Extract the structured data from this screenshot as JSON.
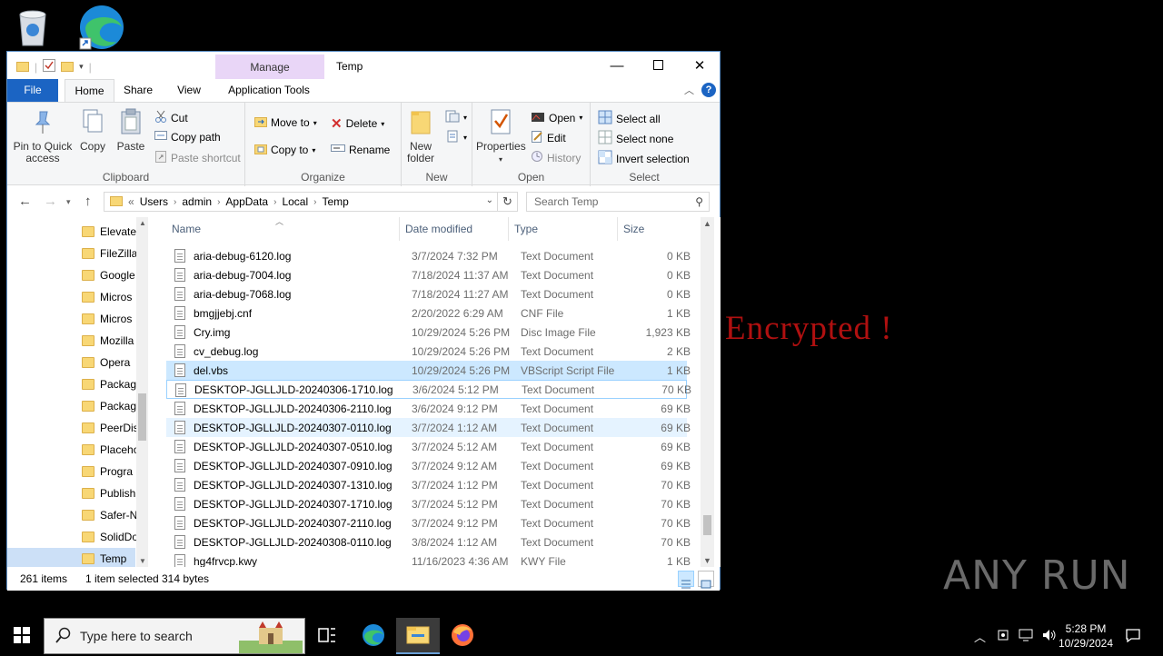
{
  "desktop": {
    "overlay_text": "Encrypted !",
    "watermark": "ANY RUN",
    "icons": [
      "recycle-bin-icon",
      "edge-shortcut-icon"
    ]
  },
  "window": {
    "title": "Temp",
    "manage_tab": "Manage",
    "tabs": {
      "file": "File",
      "home": "Home",
      "share": "Share",
      "view": "View",
      "app_tools": "Application Tools"
    },
    "help": "?"
  },
  "ribbon": {
    "clipboard": {
      "label": "Clipboard",
      "pin": "Pin to Quick access",
      "copy": "Copy",
      "paste": "Paste",
      "cut": "Cut",
      "copy_path": "Copy path",
      "paste_shortcut": "Paste shortcut"
    },
    "organize": {
      "label": "Organize",
      "move_to": "Move to",
      "copy_to": "Copy to",
      "delete": "Delete",
      "rename": "Rename"
    },
    "new": {
      "label": "New",
      "new_folder": "New folder"
    },
    "open": {
      "label": "Open",
      "properties": "Properties",
      "open": "Open",
      "edit": "Edit",
      "history": "History"
    },
    "select": {
      "label": "Select",
      "select_all": "Select all",
      "select_none": "Select none",
      "invert": "Invert selection"
    }
  },
  "address": {
    "crumbs": [
      "Users",
      "admin",
      "AppData",
      "Local",
      "Temp"
    ],
    "prefix": "«",
    "search_placeholder": "Search Temp"
  },
  "nav_pane": [
    "Elevate",
    "FileZilla",
    "Google",
    "Micros",
    "Micros",
    "Mozilla",
    "Opera",
    "Packag",
    "Packag",
    "PeerDis",
    "Placeho",
    "Progra",
    "Publish",
    "Safer-N",
    "SolidDo",
    "Temp"
  ],
  "columns": {
    "name": "Name",
    "date": "Date modified",
    "type": "Type",
    "size": "Size"
  },
  "files": [
    {
      "name": "aria-debug-6120.log",
      "date": "3/7/2024 7:32 PM",
      "type": "Text Document",
      "size": "0 KB"
    },
    {
      "name": "aria-debug-7004.log",
      "date": "7/18/2024 11:37 AM",
      "type": "Text Document",
      "size": "0 KB"
    },
    {
      "name": "aria-debug-7068.log",
      "date": "7/18/2024 11:27 AM",
      "type": "Text Document",
      "size": "0 KB"
    },
    {
      "name": "bmgjjebj.cnf",
      "date": "2/20/2022 6:29 AM",
      "type": "CNF File",
      "size": "1 KB"
    },
    {
      "name": "Cry.img",
      "date": "10/29/2024 5:26 PM",
      "type": "Disc Image File",
      "size": "1,923 KB"
    },
    {
      "name": "cv_debug.log",
      "date": "10/29/2024 5:26 PM",
      "type": "Text Document",
      "size": "2 KB"
    },
    {
      "name": "del.vbs",
      "date": "10/29/2024 5:26 PM",
      "type": "VBScript Script File",
      "size": "1 KB"
    },
    {
      "name": "DESKTOP-JGLLJLD-20240306-1710.log",
      "date": "3/6/2024 5:12 PM",
      "type": "Text Document",
      "size": "70 KB"
    },
    {
      "name": "DESKTOP-JGLLJLD-20240306-2110.log",
      "date": "3/6/2024 9:12 PM",
      "type": "Text Document",
      "size": "69 KB"
    },
    {
      "name": "DESKTOP-JGLLJLD-20240307-0110.log",
      "date": "3/7/2024 1:12 AM",
      "type": "Text Document",
      "size": "69 KB"
    },
    {
      "name": "DESKTOP-JGLLJLD-20240307-0510.log",
      "date": "3/7/2024 5:12 AM",
      "type": "Text Document",
      "size": "69 KB"
    },
    {
      "name": "DESKTOP-JGLLJLD-20240307-0910.log",
      "date": "3/7/2024 9:12 AM",
      "type": "Text Document",
      "size": "69 KB"
    },
    {
      "name": "DESKTOP-JGLLJLD-20240307-1310.log",
      "date": "3/7/2024 1:12 PM",
      "type": "Text Document",
      "size": "70 KB"
    },
    {
      "name": "DESKTOP-JGLLJLD-20240307-1710.log",
      "date": "3/7/2024 5:12 PM",
      "type": "Text Document",
      "size": "70 KB"
    },
    {
      "name": "DESKTOP-JGLLJLD-20240307-2110.log",
      "date": "3/7/2024 9:12 PM",
      "type": "Text Document",
      "size": "70 KB"
    },
    {
      "name": "DESKTOP-JGLLJLD-20240308-0110.log",
      "date": "3/8/2024 1:12 AM",
      "type": "Text Document",
      "size": "70 KB"
    },
    {
      "name": "hg4frvcp.kwy",
      "date": "11/16/2023 4:36 AM",
      "type": "KWY File",
      "size": "1 KB"
    }
  ],
  "status": {
    "count": "261 items",
    "selected": "1 item selected",
    "bytes": "314 bytes"
  },
  "taskbar": {
    "search_placeholder": "Type here to search",
    "time": "5:28 PM",
    "date": "10/29/2024"
  },
  "colors": {
    "accent": "#1b64c3",
    "selection": "#cce8ff",
    "overlay_text": "#b01010",
    "manage_tab": "#e9d6f7"
  }
}
